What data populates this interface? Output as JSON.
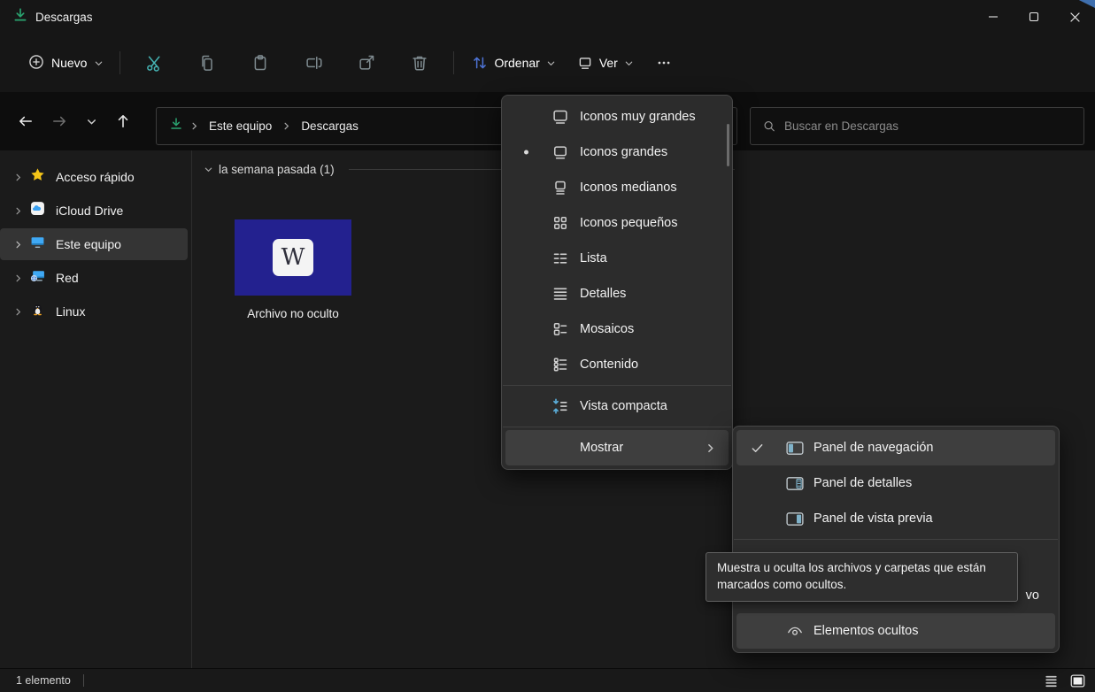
{
  "window": {
    "title": "Descargas"
  },
  "toolbar": {
    "new_label": "Nuevo",
    "sort_label": "Ordenar",
    "view_label": "Ver",
    "icons": [
      "plus-icon",
      "cut-icon",
      "copy-icon",
      "paste-icon",
      "rename-icon",
      "share-icon",
      "delete-icon",
      "sort-icon",
      "view-icon",
      "more-icon"
    ],
    "accent_cut_color": "#45b3b3",
    "accent_sort_color": "#4e74d8"
  },
  "navbar": {
    "breadcrumb_items": [
      "Este equipo",
      "Descargas"
    ],
    "search_placeholder": "Buscar en Descargas"
  },
  "sidebar": {
    "items": [
      {
        "label": "Acceso rápido",
        "icon": "star-icon"
      },
      {
        "label": "iCloud Drive",
        "icon": "icloud-icon"
      },
      {
        "label": "Este equipo",
        "icon": "computer-icon",
        "selected": true
      },
      {
        "label": "Red",
        "icon": "network-icon"
      },
      {
        "label": "Linux",
        "icon": "linux-penguin-icon"
      }
    ]
  },
  "content": {
    "group_label": "la semana pasada (1)",
    "file": {
      "name": "Archivo no oculto",
      "thumbnail_letter": "W",
      "thumbnail_color": "#23218f"
    }
  },
  "view_menu": {
    "items": [
      {
        "label": "Iconos muy grandes",
        "icon": "extra-large-icons-icon"
      },
      {
        "label": "Iconos grandes",
        "icon": "large-icons-icon",
        "selected": true
      },
      {
        "label": "Iconos medianos",
        "icon": "medium-icons-icon"
      },
      {
        "label": "Iconos pequeños",
        "icon": "small-icons-icon"
      },
      {
        "label": "Lista",
        "icon": "list-icon"
      },
      {
        "label": "Detalles",
        "icon": "details-icon"
      },
      {
        "label": "Mosaicos",
        "icon": "tiles-icon"
      },
      {
        "label": "Contenido",
        "icon": "content-icon"
      },
      {
        "label": "Vista compacta",
        "icon": "compact-view-icon",
        "accent_color": "#5badd9"
      },
      {
        "label": "Mostrar",
        "has_submenu": true,
        "hovered": true
      }
    ]
  },
  "show_submenu": {
    "items": [
      {
        "label": "Panel de navegación",
        "icon": "navigation-pane-icon",
        "checked": true,
        "highlighted": true
      },
      {
        "label": "Panel de detalles",
        "icon": "details-pane-icon"
      },
      {
        "label": "Panel de vista previa",
        "icon": "preview-pane-icon"
      },
      {
        "label": "",
        "icon": "checkboxes-icon",
        "partially_hidden_by_tooltip": true
      },
      {
        "visible_fragment": "vo",
        "hidden_by_tooltip": true
      },
      {
        "label": "Elementos ocultos",
        "icon": "hidden-items-eye-icon",
        "hovered": true
      }
    ]
  },
  "tooltip": {
    "line1": "Muestra u oculta los archivos y carpetas que están",
    "line2": "marcados como ocultos."
  },
  "statusbar": {
    "item_count": "1 elemento",
    "view_toggles": [
      "list-view-icon",
      "large-thumbnails-view-icon"
    ]
  }
}
